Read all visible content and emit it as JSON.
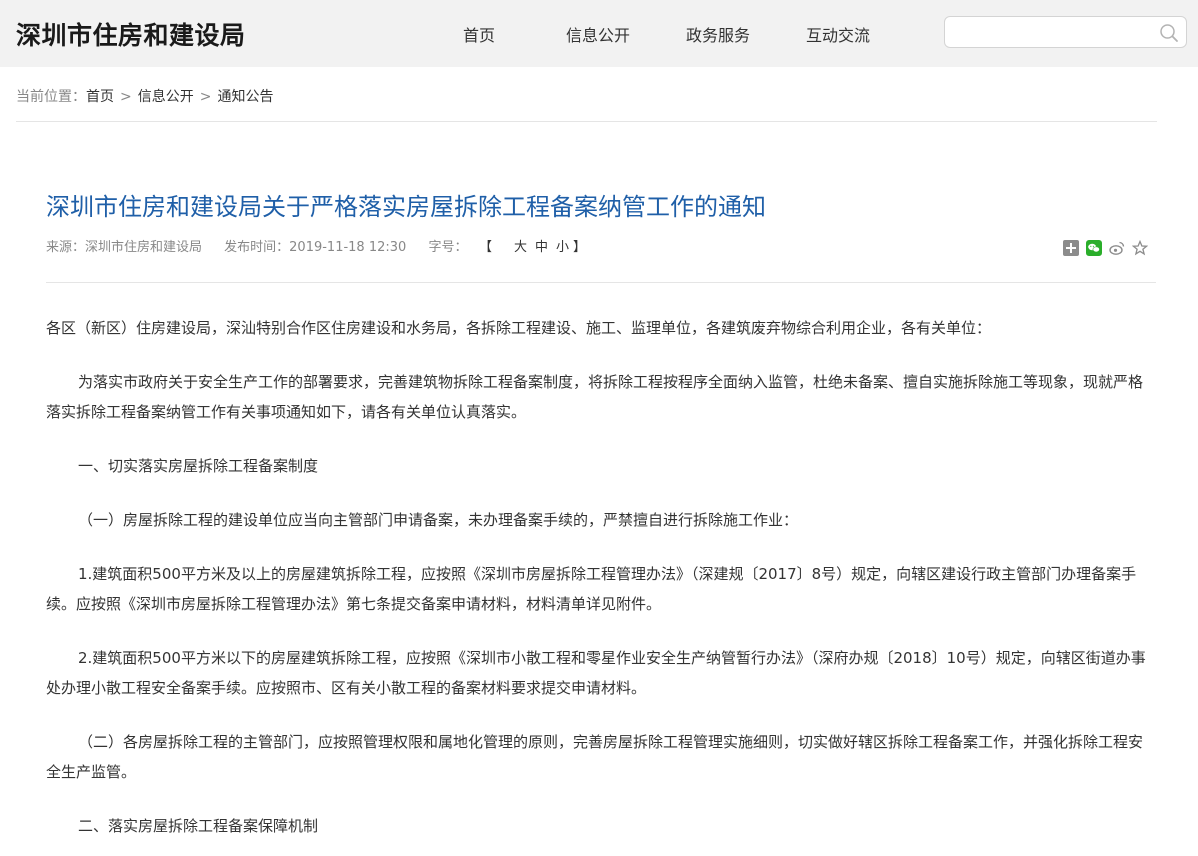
{
  "header": {
    "site_title": "深圳市住房和建设局",
    "nav": [
      "首页",
      "信息公开",
      "政务服务",
      "互动交流"
    ],
    "search": {
      "value": "",
      "placeholder": ""
    }
  },
  "breadcrumb": {
    "prefix": "当前位置：",
    "items": [
      "首页",
      "信息公开",
      "通知公告"
    ],
    "separator": ">"
  },
  "article": {
    "title": "深圳市住房和建设局关于严格落实房屋拆除工程备案纳管工作的通知",
    "source": "来源：深圳市住房和建设局",
    "published": "发布时间：2019-11-18 12:30",
    "font_size_label": "字号：",
    "font_size_open": "【",
    "font_size_options": [
      "大",
      "中",
      "小"
    ],
    "font_size_close": "】",
    "share_icons": [
      "share-plus-icon",
      "wechat-icon",
      "weibo-icon",
      "favorite-star-icon"
    ],
    "paragraphs": [
      "各区（新区）住房建设局，深汕特别合作区住房建设和水务局，各拆除工程建设、施工、监理单位，各建筑废弃物综合利用企业，各有关单位：",
      "为落实市政府关于安全生产工作的部署要求，完善建筑物拆除工程备案制度，将拆除工程按程序全面纳入监管，杜绝未备案、擅自实施拆除施工等现象，现就严格落实拆除工程备案纳管工作有关事项通知如下，请各有关单位认真落实。",
      "一、切实落实房屋拆除工程备案制度",
      "（一）房屋拆除工程的建设单位应当向主管部门申请备案，未办理备案手续的，严禁擅自进行拆除施工作业：",
      "1.建筑面积500平方米及以上的房屋建筑拆除工程，应按照《深圳市房屋拆除工程管理办法》（深建规〔2017〕8号）规定，向辖区建设行政主管部门办理备案手续。应按照《深圳市房屋拆除工程管理办法》第七条提交备案申请材料，材料清单详见附件。",
      "2.建筑面积500平方米以下的房屋建筑拆除工程，应按照《深圳市小散工程和零星作业安全生产纳管暂行办法》（深府办规〔2018〕10号）规定，向辖区街道办事处办理小散工程安全备案手续。应按照市、区有关小散工程的备案材料要求提交申请材料。",
      "（二）各房屋拆除工程的主管部门，应按照管理权限和属地化管理的原则，完善房屋拆除工程管理实施细则，切实做好辖区拆除工程备案工作，并强化拆除工程安全生产监管。",
      "二、落实房屋拆除工程备案保障机制"
    ]
  },
  "colors": {
    "title_blue": "#1f5fa8",
    "header_bg": "#f2f2f2"
  }
}
